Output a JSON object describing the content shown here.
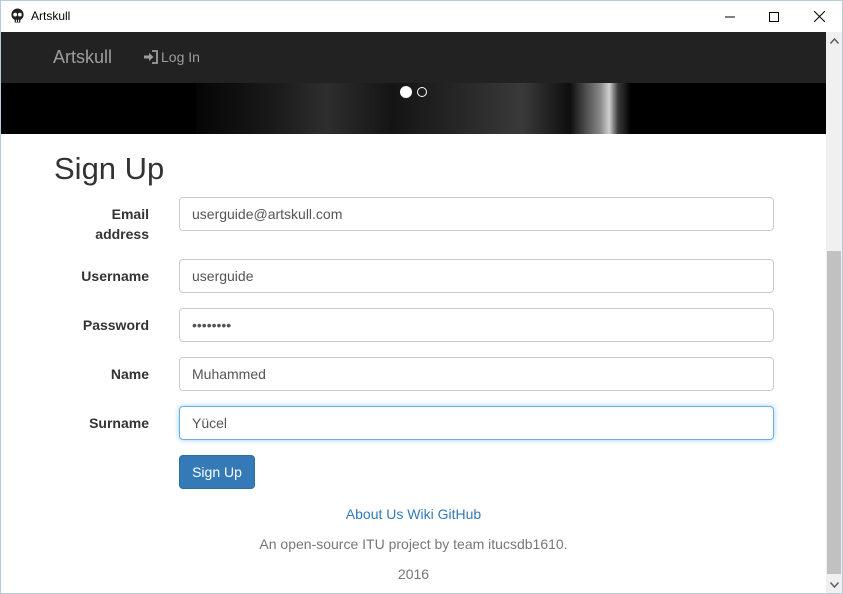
{
  "window": {
    "title": "Artskull",
    "icon": "skull-icon",
    "controls": [
      "minimize-icon",
      "maximize-icon",
      "close-icon"
    ]
  },
  "navbar": {
    "brand": "Artskull",
    "login_label": "Log In",
    "login_icon": "login-icon"
  },
  "carousel": {
    "indicators": 2,
    "active_index": 0
  },
  "form": {
    "title": "Sign Up",
    "fields": {
      "email": {
        "label": "Email address",
        "value": "userguide@artskull.com"
      },
      "username": {
        "label": "Username",
        "value": "userguide"
      },
      "password": {
        "label": "Password",
        "value": "••••••••"
      },
      "name": {
        "label": "Name",
        "value": "Muhammed"
      },
      "surname": {
        "label": "Surname",
        "value": "Yücel"
      }
    },
    "submit_label": "Sign Up"
  },
  "footer": {
    "links": [
      "About Us",
      "Wiki",
      "GitHub"
    ],
    "tagline": "An open-source ITU project by team itucsdb1610.",
    "year": "2016"
  },
  "colors": {
    "navbar_bg": "#222222",
    "primary": "#337ab7",
    "link": "#337ab7",
    "focus_border": "#66afe9"
  }
}
